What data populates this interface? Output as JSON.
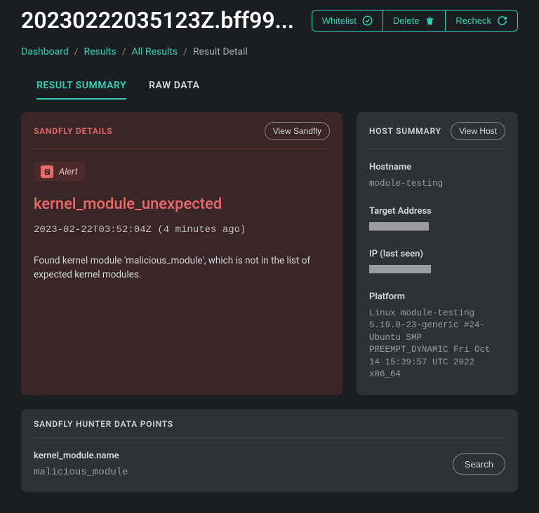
{
  "title": "20230222035123Z.bff99...",
  "actions": {
    "whitelist": "Whitelist",
    "delete": "Delete",
    "recheck": "Recheck"
  },
  "breadcrumbs": {
    "items": [
      {
        "label": "Dashboard"
      },
      {
        "label": "Results"
      },
      {
        "label": "All Results"
      }
    ],
    "current": "Result Detail"
  },
  "tabs": {
    "summary": "RESULT SUMMARY",
    "raw": "RAW DATA"
  },
  "sandfly_details": {
    "title": "SANDFLY DETAILS",
    "view_button": "View Sandfly",
    "alert_label": "Alert",
    "name": "kernel_module_unexpected",
    "timestamp": "2023-02-22T03:52:04Z (4 minutes ago)",
    "description": "Found kernel module 'malicious_module', which is not in the list of expected kernel modules."
  },
  "host_summary": {
    "title": "HOST SUMMARY",
    "view_button": "View Host",
    "fields": {
      "hostname_label": "Hostname",
      "hostname_value": "module-testing",
      "target_label": "Target Address",
      "ip_label": "IP (last seen)",
      "platform_label": "Platform",
      "platform_value": "Linux module-testing 5.19.0-23-generic #24-Ubuntu SMP PREEMPT_DYNAMIC Fri Oct 14 15:39:57 UTC 2022 x86_64"
    }
  },
  "hunter": {
    "title": "SANDFLY HUNTER DATA POINTS",
    "key": "kernel_module.name",
    "value": "malicious_module",
    "search_button": "Search"
  }
}
